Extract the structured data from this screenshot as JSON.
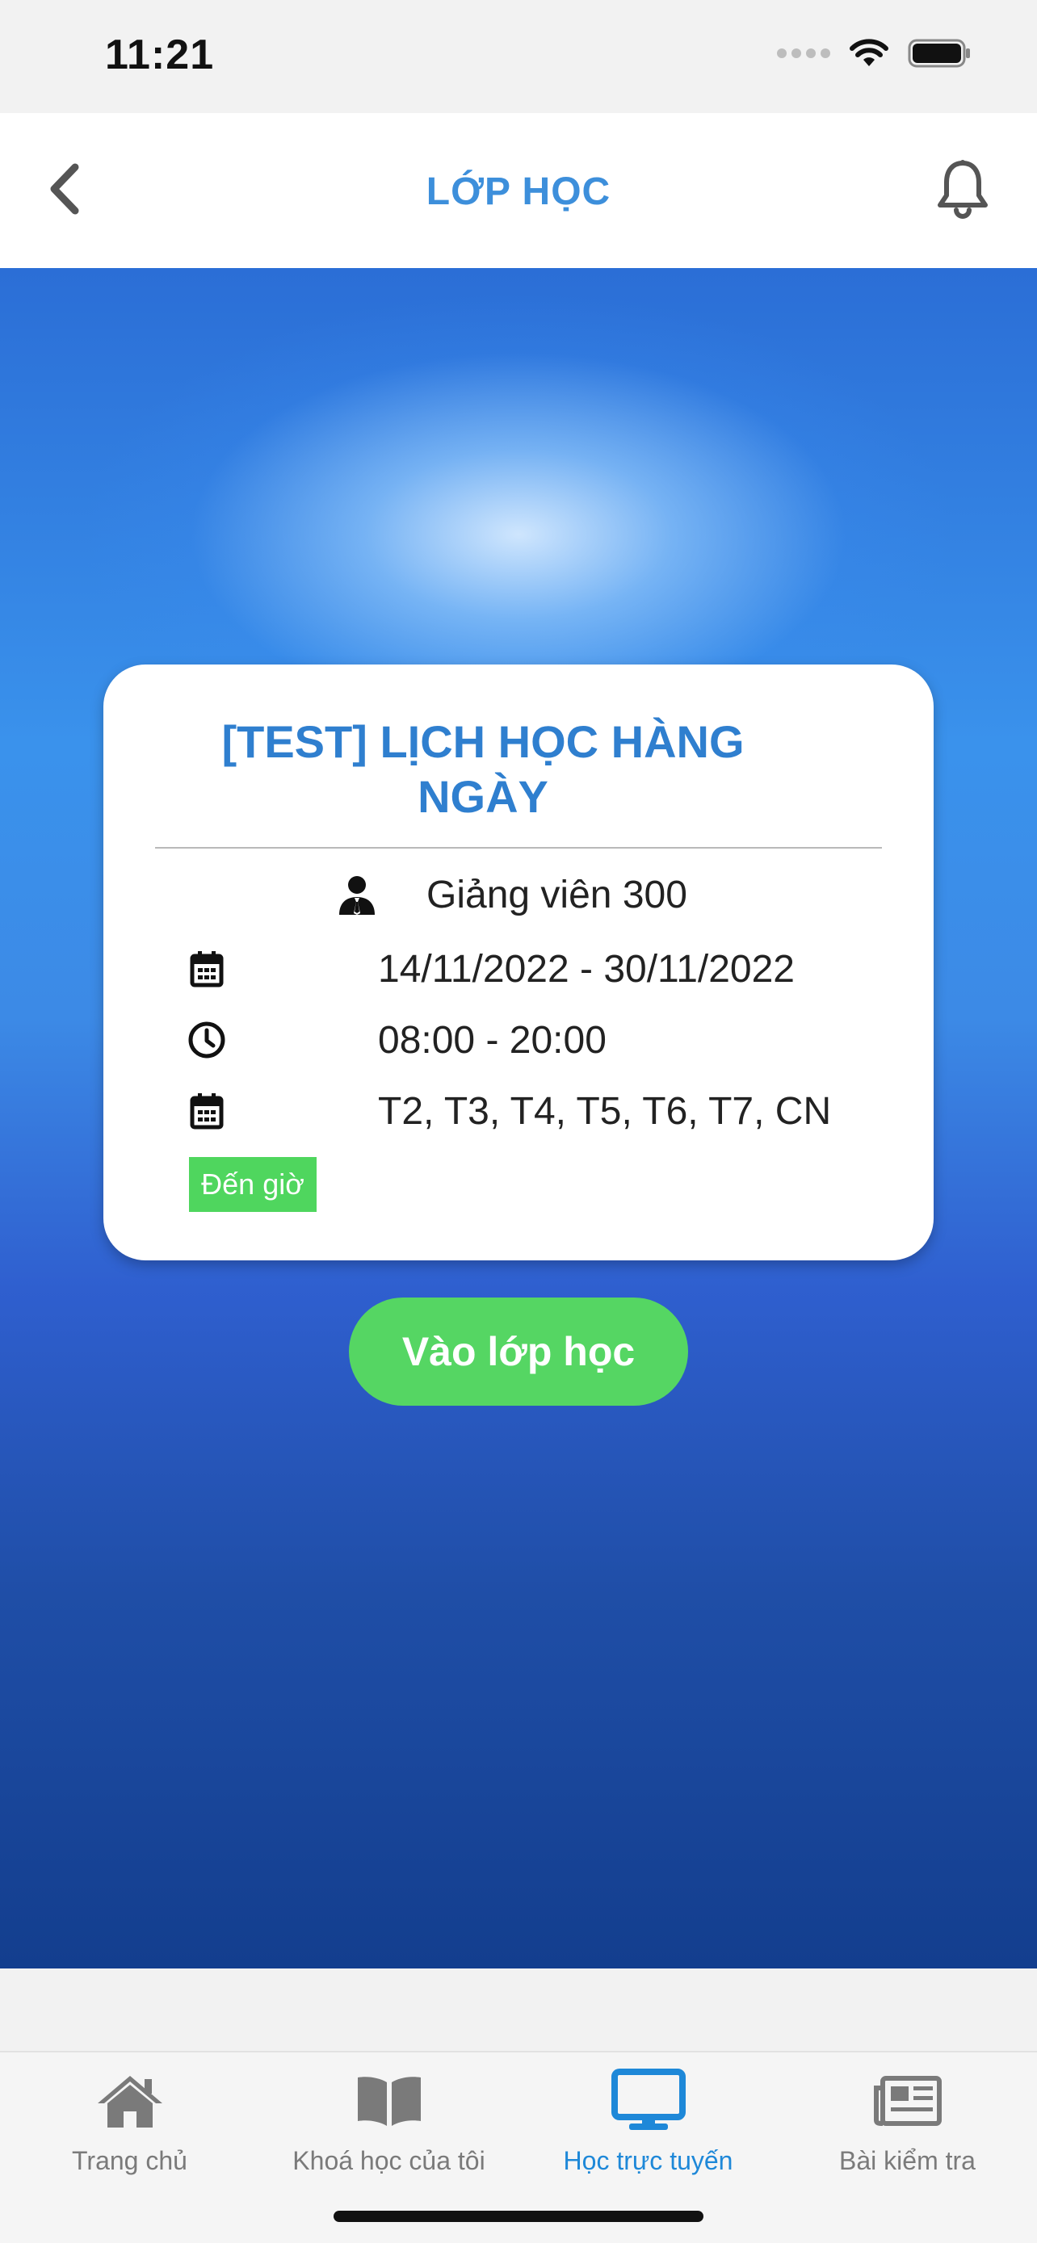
{
  "status_bar": {
    "time": "11:21"
  },
  "header": {
    "title": "LỚP HỌC"
  },
  "class_card": {
    "title": "[TEST] LỊCH HỌC HÀNG NGÀY",
    "teacher": "Giảng viên 300",
    "date_range": "14/11/2022 - 30/11/2022",
    "time_range": "08:00 - 20:00",
    "days": "T2, T3, T4, T5, T6, T7, CN",
    "status_badge": "Đến giờ"
  },
  "join_button": {
    "label": "Vào lớp học"
  },
  "tabs": [
    {
      "label": "Trang chủ",
      "icon": "home-icon",
      "active": false
    },
    {
      "label": "Khoá học của tôi",
      "icon": "book-icon",
      "active": false
    },
    {
      "label": "Học trực tuyến",
      "icon": "monitor-icon",
      "active": true
    },
    {
      "label": "Bài kiểm tra",
      "icon": "newspaper-icon",
      "active": false
    }
  ],
  "colors": {
    "accent": "#3d8fdb",
    "card_title": "#2f7fcf",
    "success": "#55d663",
    "active_tab": "#1e88d8"
  }
}
